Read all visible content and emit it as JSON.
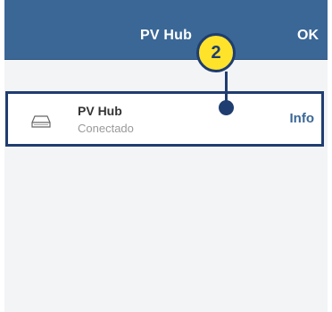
{
  "navbar": {
    "title": "PV Hub",
    "ok_label": "OK"
  },
  "device_row": {
    "name": "PV Hub",
    "status": "Conectado",
    "info_label": "Info",
    "icon": "device-drive-icon"
  },
  "callout": {
    "number": "2"
  },
  "colors": {
    "navbar": "#3a6796",
    "accent_border": "#1f3d70",
    "callout_fill": "#ffe32b",
    "background": "#f3f4f6"
  }
}
